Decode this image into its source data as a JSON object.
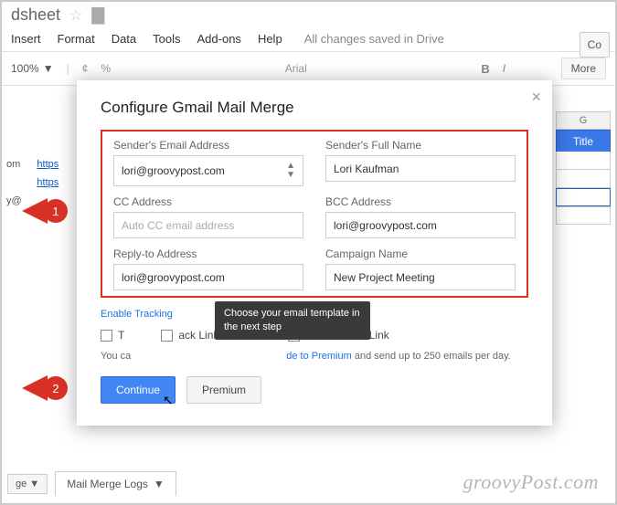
{
  "title_fragment": "dsheet",
  "menu": {
    "insert": "Insert",
    "format": "Format",
    "data": "Data",
    "tools": "Tools",
    "addons": "Add-ons",
    "help": "Help",
    "saved": "All changes saved in Drive",
    "co": "Co"
  },
  "toolbar": {
    "zoom": "100%",
    "font": "Arial",
    "bold": "B",
    "more": "More"
  },
  "sheet": {
    "col_g": "G",
    "title_header": "Title",
    "link": "https",
    "row_om": "om",
    "row_at": "y@"
  },
  "dialog": {
    "title": "Configure Gmail Mail Merge",
    "sender_email_label": "Sender's Email Address",
    "sender_email_value": "lori@groovypost.com",
    "sender_name_label": "Sender's Full Name",
    "sender_name_value": "Lori Kaufman",
    "cc_label": "CC Address",
    "cc_placeholder": "Auto CC email address",
    "bcc_label": "BCC Address",
    "bcc_value": "lori@groovypost.com",
    "reply_label": "Reply-to Address",
    "reply_value": "lori@groovypost.com",
    "campaign_label": "Campaign Name",
    "campaign_value": "New Project Meeting",
    "enable_tracking": "Enable Tracking",
    "track_link": "ack Link Clicks",
    "t_label": "T",
    "unsubscribe": "Unsubscribe Link",
    "subtext_prefix": "You ca",
    "upgrade": "de to Premium",
    "subtext_suffix": " and send up to 250 emails per day.",
    "continue": "Continue",
    "premium": "Premium",
    "tooltip": "Choose your email template in the next step"
  },
  "callouts": {
    "one": "1",
    "two": "2"
  },
  "sheettab": {
    "ge": "ge",
    "name": "Mail Merge Logs"
  },
  "watermark": "groovyPost.com"
}
